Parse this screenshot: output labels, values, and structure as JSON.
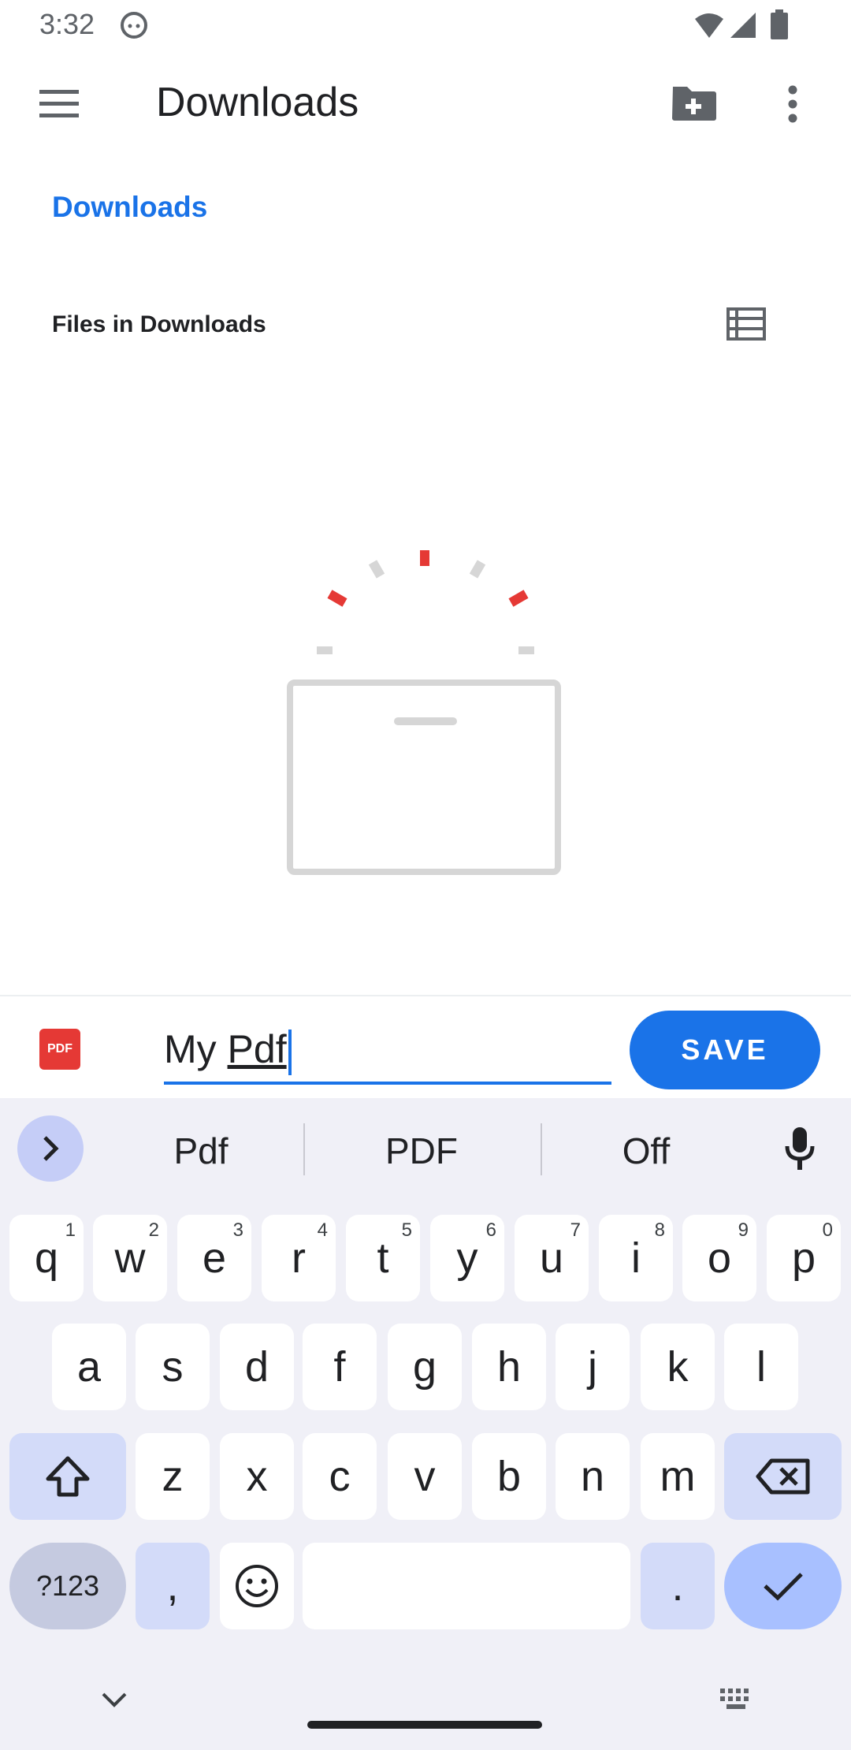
{
  "status_bar": {
    "time": "3:32"
  },
  "app_bar": {
    "title": "Downloads"
  },
  "breadcrumb": {
    "label": "Downloads"
  },
  "section": {
    "title": "Files in Downloads"
  },
  "save_bar": {
    "file_icon_label": "PDF",
    "filename_prefix": "My ",
    "filename_underlined": "Pdf",
    "save_label": "SAVE"
  },
  "keyboard": {
    "suggestions": [
      "Pdf",
      "PDF",
      "Off"
    ],
    "row1": [
      {
        "k": "q",
        "h": "1"
      },
      {
        "k": "w",
        "h": "2"
      },
      {
        "k": "e",
        "h": "3"
      },
      {
        "k": "r",
        "h": "4"
      },
      {
        "k": "t",
        "h": "5"
      },
      {
        "k": "y",
        "h": "6"
      },
      {
        "k": "u",
        "h": "7"
      },
      {
        "k": "i",
        "h": "8"
      },
      {
        "k": "o",
        "h": "9"
      },
      {
        "k": "p",
        "h": "0"
      }
    ],
    "row2": [
      "a",
      "s",
      "d",
      "f",
      "g",
      "h",
      "j",
      "k",
      "l"
    ],
    "row3": [
      "z",
      "x",
      "c",
      "v",
      "b",
      "n",
      "m"
    ],
    "symbols_label": "?123",
    "comma": ",",
    "period": "."
  },
  "colors": {
    "accent": "#1a73e8",
    "pdf": "#e53935",
    "loader_red": "#e53935",
    "loader_grey": "#d6d6d6"
  }
}
